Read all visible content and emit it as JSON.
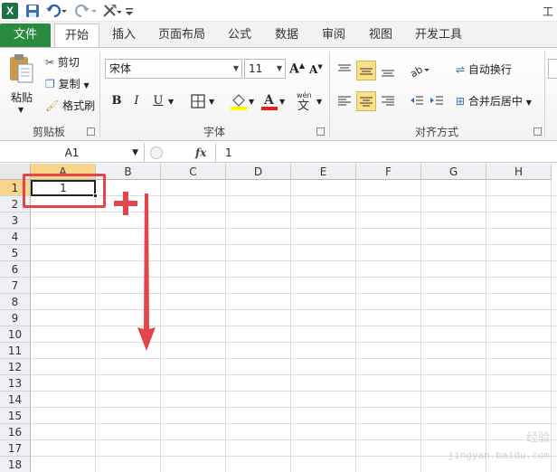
{
  "qat": {
    "title_fragment": "工"
  },
  "tabs": [
    {
      "label": "文件"
    },
    {
      "label": "开始"
    },
    {
      "label": "插入"
    },
    {
      "label": "页面布局"
    },
    {
      "label": "公式"
    },
    {
      "label": "数据"
    },
    {
      "label": "审阅"
    },
    {
      "label": "视图"
    },
    {
      "label": "开发工具"
    }
  ],
  "clipboard": {
    "paste": "粘贴",
    "cut": "剪切",
    "copy": "复制",
    "format_painter": "格式刷",
    "group_label": "剪贴板"
  },
  "font": {
    "name": "宋体",
    "size": "11",
    "bold": "B",
    "italic": "I",
    "underline": "U",
    "group_label": "字体"
  },
  "alignment": {
    "wrap_text": "自动换行",
    "merge_center": "合并后居中",
    "group_label": "对齐方式"
  },
  "formula_bar": {
    "name_box": "A1",
    "fx": "fx",
    "content": "1"
  },
  "grid": {
    "columns": [
      "A",
      "B",
      "C",
      "D",
      "E",
      "F",
      "G",
      "H"
    ],
    "rows": [
      "1",
      "2",
      "3",
      "4",
      "5",
      "6",
      "7",
      "8",
      "9",
      "10",
      "11",
      "12",
      "13",
      "14",
      "15",
      "16",
      "17",
      "18"
    ],
    "cell_a1": "1"
  },
  "colors": {
    "file_tab": "#2a8a3e",
    "selection_header": "#f8d58a",
    "annotation": "#e2454a"
  },
  "watermark": {
    "line1": "经验",
    "line2": "jingyan.baidu.com"
  }
}
